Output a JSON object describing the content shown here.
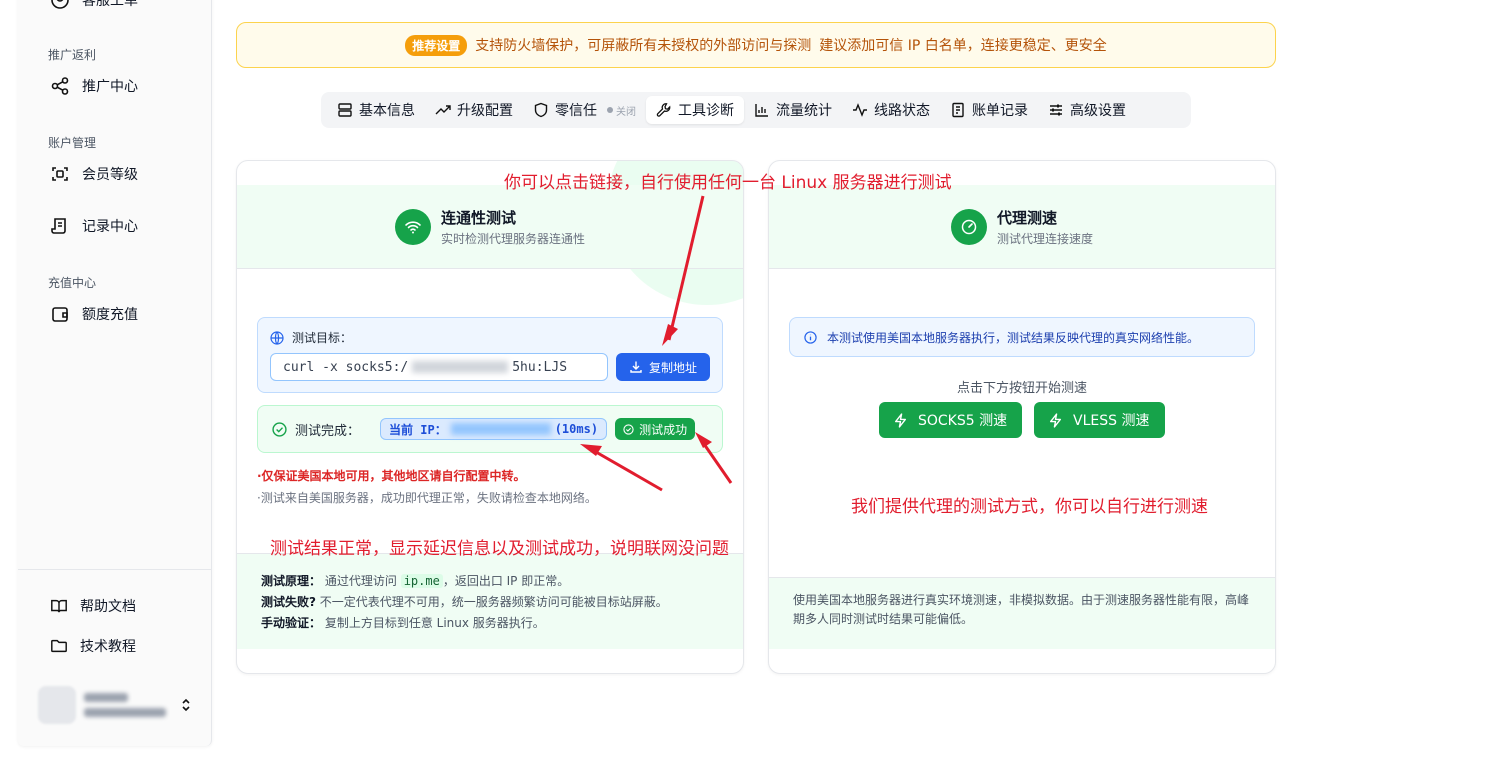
{
  "sidebar": {
    "top_item_label": "客服工单",
    "groups": [
      {
        "label": "推广返利",
        "items": [
          {
            "label": "推广中心",
            "icon": "share-icon"
          }
        ]
      },
      {
        "label": "账户管理",
        "items": [
          {
            "label": "会员等级",
            "icon": "scan-icon"
          },
          {
            "label": "记录中心",
            "icon": "scroll-icon"
          }
        ]
      },
      {
        "label": "充值中心",
        "items": [
          {
            "label": "额度充值",
            "icon": "wallet-icon"
          }
        ]
      }
    ],
    "bottom_items": [
      {
        "label": "帮助文档",
        "icon": "book-icon"
      },
      {
        "label": "技术教程",
        "icon": "folder-icon"
      }
    ]
  },
  "banner": {
    "badge": "推荐设置",
    "text": "支持防火墙保护，可屏蔽所有未授权的外部访问与探测",
    "suggestion": "建议添加可信 IP 白名单，连接更稳定、更安全"
  },
  "tabs": [
    {
      "label": "基本信息",
      "icon": "server-icon"
    },
    {
      "label": "升级配置",
      "icon": "trending-up-icon"
    },
    {
      "label": "零信任",
      "icon": "shield-icon",
      "status": "关闭"
    },
    {
      "label": "工具诊断",
      "icon": "wrench-icon",
      "active": true
    },
    {
      "label": "流量统计",
      "icon": "bar-chart-icon"
    },
    {
      "label": "线路状态",
      "icon": "activity-icon"
    },
    {
      "label": "账单记录",
      "icon": "receipt-icon"
    },
    {
      "label": "高级设置",
      "icon": "sliders-icon"
    }
  ],
  "connectivity": {
    "title": "连通性测试",
    "subtitle": "实时检测代理服务器连通性",
    "target_label": "测试目标：",
    "target_prefix": "curl -x socks5:/",
    "target_mid": "yusat.",
    "target_suffix": "5hu:LJS",
    "copy_button": "复制地址",
    "result_label": "测试完成：",
    "ip_prefix": "当前 IP：",
    "ip_suffix": "(10ms)",
    "success_badge": "测试成功",
    "note_red": "·仅保证美国本地可用，其他地区请自行配置中转。",
    "note_gray": "·测试来自美国服务器，成功即代理正常，失败请检查本地网络。",
    "footer": {
      "principle_label": "测试原理：",
      "principle_text_a": "通过代理访问",
      "principle_code": "ip.me",
      "principle_text_b": "，返回出口 IP 即正常。",
      "fail_label": "测试失败?",
      "fail_text": "不一定代表代理不可用，统一服务器频繁访问可能被目标站屏蔽。",
      "manual_label": "手动验证：",
      "manual_text": "复制上方目标到任意 Linux 服务器执行。"
    }
  },
  "speedtest": {
    "title": "代理测速",
    "subtitle": "测试代理连接速度",
    "info": "本测试使用美国本地服务器执行，测试结果反映代理的真实网络性能。",
    "prompt": "点击下方按钮开始测速",
    "socks5_button": "SOCKS5 测速",
    "vless_button": "VLESS 测速",
    "footer_text": "使用美国本地服务器进行真实环境测速，非模拟数据。由于测速服务器性能有限，高峰期多人同时测试时结果可能偏低。"
  },
  "annotations": {
    "top": "你可以点击链接，自行使用任何一台 Linux 服务器进行测试",
    "bottom_left": "测试结果正常，显示延迟信息以及测试成功，说明联网没问题",
    "right": "我们提供代理的测试方式，你可以自行进行测速"
  },
  "colors": {
    "primary_green": "#16a34a",
    "primary_blue": "#2563eb",
    "annotation_red": "#e11d2e",
    "banner_amber": "#f59e0b"
  }
}
